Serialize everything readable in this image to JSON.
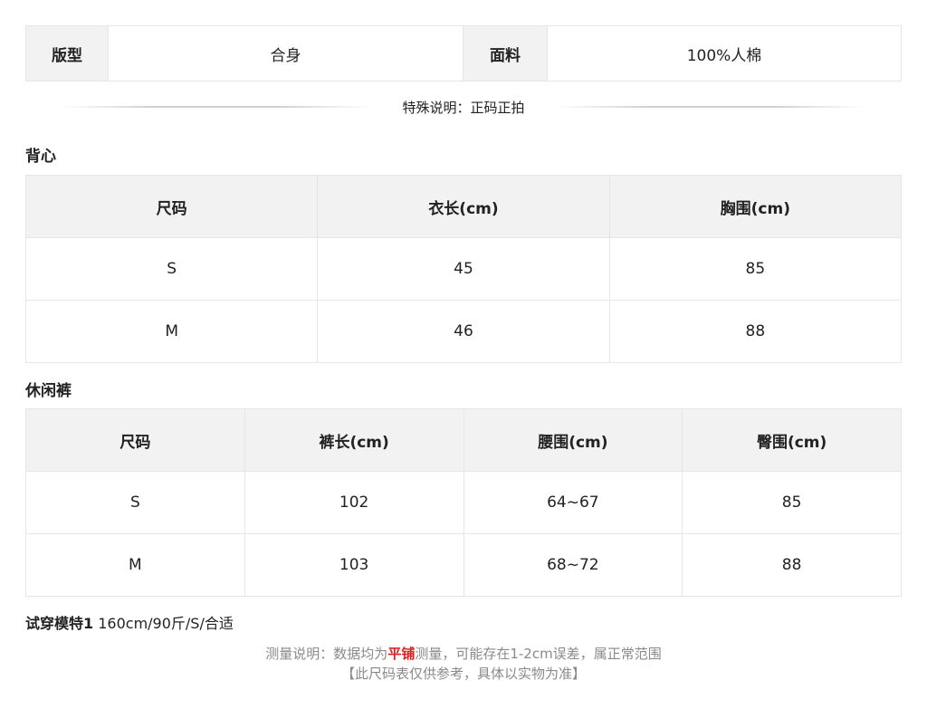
{
  "info": {
    "fit_label": "版型",
    "fit_value": "合身",
    "fabric_label": "面料",
    "fabric_value": "100%人棉"
  },
  "special_note": "特殊说明：正码正拍",
  "vest": {
    "title": "背心",
    "headers": [
      "尺码",
      "衣长(cm)",
      "胸围(cm)"
    ],
    "rows": [
      [
        "S",
        "45",
        "85"
      ],
      [
        "M",
        "46",
        "88"
      ]
    ]
  },
  "pants": {
    "title": "休闲裤",
    "headers": [
      "尺码",
      "裤长(cm)",
      "腰围(cm)",
      "臀围(cm)"
    ],
    "rows": [
      [
        "S",
        "102",
        "64~67",
        "85"
      ],
      [
        "M",
        "103",
        "68~72",
        "88"
      ]
    ]
  },
  "model": {
    "label": "试穿模特1",
    "detail": "160cm/90斤/S/合适"
  },
  "footer": {
    "line1_prefix": "测量说明：数据均为",
    "line1_highlight": "平铺",
    "line1_suffix": "测量，可能存在1-2cm误差，属正常范围",
    "line2": "【此尺码表仅供参考，具体以实物为准】"
  },
  "colors": {
    "highlight": "#e01e1e",
    "header_bg": "#f2f2f2",
    "border": "#e6e6e6",
    "muted_text": "#8a8a8a"
  }
}
